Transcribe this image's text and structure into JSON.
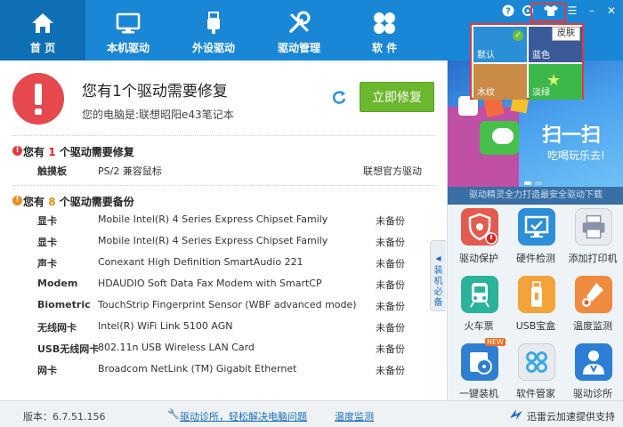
{
  "nav": {
    "tabs": [
      {
        "label": "首 页",
        "icon": "home-icon"
      },
      {
        "label": "本机驱动",
        "icon": "monitor-icon"
      },
      {
        "label": "外设驱动",
        "icon": "usb-icon"
      },
      {
        "label": "驱动管理",
        "icon": "wrench-icon"
      },
      {
        "label": "软 件",
        "icon": "apps-icon"
      }
    ],
    "active": 0
  },
  "window_controls": {
    "help": "?",
    "skin": "皮肤",
    "menu": "☰",
    "minimize": "–",
    "close": "✕"
  },
  "alert": {
    "title": "您有1个驱动需要修复",
    "subtitle": "您的电脑是:联想昭阳e43笔记本",
    "fix_button": "立即修复"
  },
  "repair_section": {
    "prefix": "您有 ",
    "count": "1",
    "suffix": " 个驱动需要修复",
    "rows": [
      {
        "type": "触摸板",
        "device": "PS/2 兼容鼠标",
        "status": "联想官方驱动"
      }
    ]
  },
  "backup_section": {
    "prefix": "您有 ",
    "count": "8",
    "suffix": " 个驱动需要备份",
    "rows": [
      {
        "type": "显卡",
        "device": "Mobile Intel(R) 4 Series Express Chipset Family",
        "status": "未备份"
      },
      {
        "type": "显卡",
        "device": "Mobile Intel(R) 4 Series Express Chipset Family",
        "status": "未备份"
      },
      {
        "type": "声卡",
        "device": "Conexant High Definition SmartAudio 221",
        "status": "未备份"
      },
      {
        "type": "Modem",
        "device": "HDAUDIO Soft Data Fax Modem with SmartCP",
        "status": "未备份"
      },
      {
        "type": "Biometric",
        "device": "TouchStrip Fingerprint Sensor (WBF advanced mode)",
        "status": "未备份"
      },
      {
        "type": "无线网卡",
        "device": "Intel(R) WiFi Link 5100 AGN",
        "status": "未备份"
      },
      {
        "type": "USB无线网卡",
        "device": "802.11n USB Wireless LAN Card",
        "status": "未备份"
      },
      {
        "type": "网卡",
        "device": "Broadcom NetLink (TM) Gigabit Ethernet",
        "status": "未备份"
      }
    ]
  },
  "side_tab": "装机必备",
  "banner": {
    "headline": "扫一扫",
    "tagline": "吃喝玩乐去!",
    "strip": "驱动精灵全力打造最安全驱动下载"
  },
  "tools": [
    {
      "label": "驱动保护",
      "color": "#e55a4e",
      "icon": "shield-gear-icon"
    },
    {
      "label": "硬件检测",
      "color": "#2c8fd8",
      "icon": "monitor-check-icon"
    },
    {
      "label": "添加打印机",
      "color": "#8a93a8",
      "icon": "printer-icon"
    },
    {
      "label": "火车票",
      "color": "#2ab39a",
      "icon": "train-icon"
    },
    {
      "label": "USB宝盒",
      "color": "#f2a33a",
      "icon": "usb-stick-icon"
    },
    {
      "label": "温度监测",
      "color": "#f08a3e",
      "icon": "thermometer-icon"
    },
    {
      "label": "一键装机",
      "color": "#2f7fd0",
      "icon": "disc-install-icon",
      "badge": "NEW"
    },
    {
      "label": "软件管家",
      "color": "#39a9e0",
      "icon": "apps-manager-icon"
    },
    {
      "label": "驱动诊所",
      "color": "#2c7fd4",
      "icon": "doctor-icon"
    }
  ],
  "footer": {
    "version": "版本：6.7.51.156",
    "link1": "驱动诊所，轻松解决电脑问题",
    "link2": "温度监测",
    "support": "迅雷云加速提供支持"
  },
  "skin_popup": {
    "label": "皮肤",
    "tiles": [
      {
        "name": "默认",
        "color": "#2b8fd8",
        "selected": true
      },
      {
        "name": "蓝色",
        "color": "#3a5a9a"
      },
      {
        "name": "木纹",
        "color": "#c98b45"
      },
      {
        "name": "淡绿",
        "color": "#3cb84a"
      }
    ]
  }
}
